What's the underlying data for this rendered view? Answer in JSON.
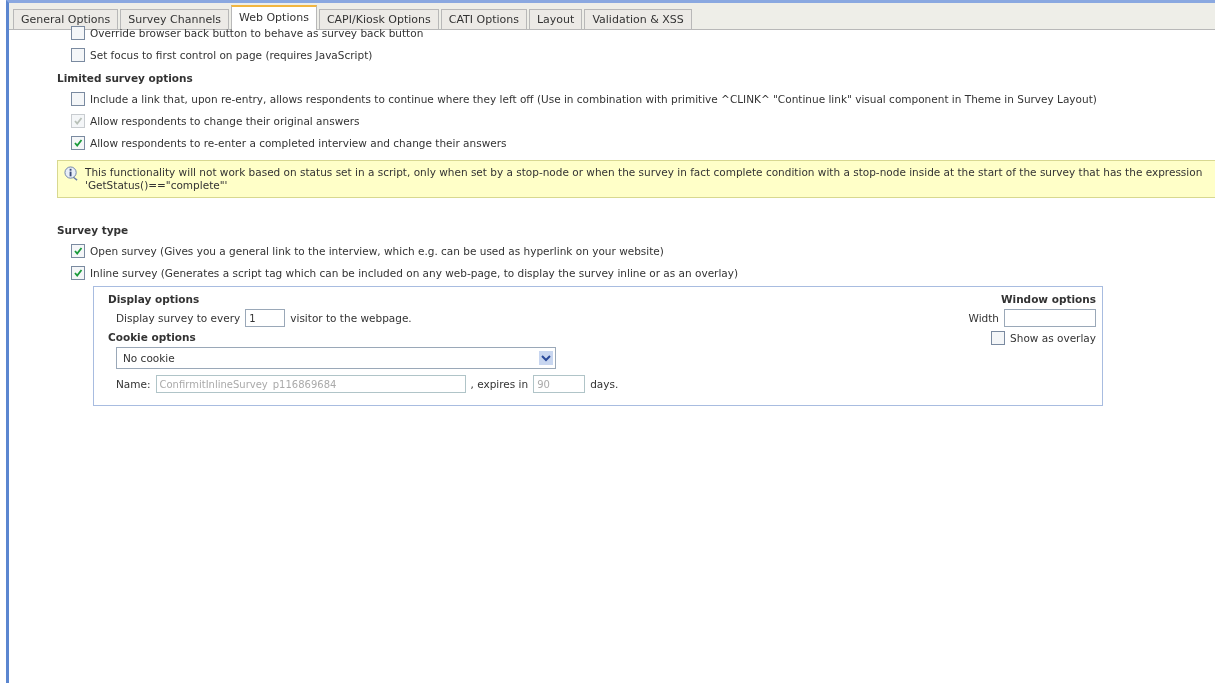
{
  "tabs": [
    {
      "label": "General Options",
      "selected": false
    },
    {
      "label": "Survey Channels",
      "selected": false
    },
    {
      "label": "Web Options",
      "selected": true
    },
    {
      "label": "CAPI/Kiosk Options",
      "selected": false
    },
    {
      "label": "CATI Options",
      "selected": false
    },
    {
      "label": "Layout",
      "selected": false
    },
    {
      "label": "Validation & XSS",
      "selected": false
    }
  ],
  "top_options": [
    {
      "label": "Override browser back button to behave as survey back button",
      "checked": false,
      "disabled": false
    },
    {
      "label": "Set focus to first control on page (requires JavaScript)",
      "checked": false,
      "disabled": false
    }
  ],
  "limited_survey": {
    "heading": "Limited survey options",
    "options": [
      {
        "label": "Include a link that, upon re-entry, allows respondents to continue where they left off (Use in combination with primitive ^CLINK^ \"Continue link\" visual component in Theme in Survey Layout)",
        "checked": false,
        "disabled": false
      },
      {
        "label": "Allow respondents to change their original answers",
        "checked": true,
        "disabled": true
      },
      {
        "label": "Allow respondents to re-enter a completed interview and change their answers",
        "checked": true,
        "disabled": false
      }
    ],
    "info": "This functionality will not work based on status set in a script, only when set by a stop-node or when the survey in fact complete condition with a stop-node inside at the start of the survey that has the expression 'GetStatus()==\"complete\"'"
  },
  "survey_type": {
    "heading": "Survey type",
    "options": [
      {
        "label": "Open survey (Gives you a general link to the interview, which e.g. can be used as hyperlink on your website)",
        "checked": true,
        "disabled": false
      },
      {
        "label": "Inline survey (Generates a script tag which can be included on any web-page, to display the survey inline or as an overlay)",
        "checked": true,
        "disabled": false
      }
    ]
  },
  "inline_panel": {
    "display_heading": "Display options",
    "display_prefix": "Display survey to every",
    "display_value": "1",
    "display_suffix": "visitor to the webpage.",
    "cookie_heading": "Cookie options",
    "cookie_select": "No cookie",
    "name_label": "Name:",
    "name_value": "ConfirmitInlineSurvey_p116869684",
    "expires_label": ", expires in",
    "expires_value": "90",
    "days_label": "days.",
    "window_heading": "Window options",
    "width_label": "Width",
    "overlay": {
      "label": "Show as overlay",
      "checked": false,
      "disabled": false
    }
  }
}
